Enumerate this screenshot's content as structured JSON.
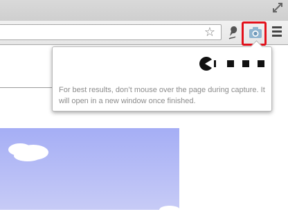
{
  "browser": {
    "omnibox": {
      "value": "",
      "placeholder": ""
    },
    "icons": {
      "bookmark": "star-icon",
      "extension": "pen-extension-icon",
      "capture": "camera-icon",
      "menu": "hamburger-menu-icon",
      "resize": "resize-icon"
    },
    "highlight_color": "#e3111b"
  },
  "popup": {
    "message": "For best results, don’t mouse over the page during capture. It will open in a new window once finished.",
    "loader_icon": "pacman-loader-icon"
  },
  "colors": {
    "sky": "#a5aef5",
    "cloud": "#ffffff"
  }
}
